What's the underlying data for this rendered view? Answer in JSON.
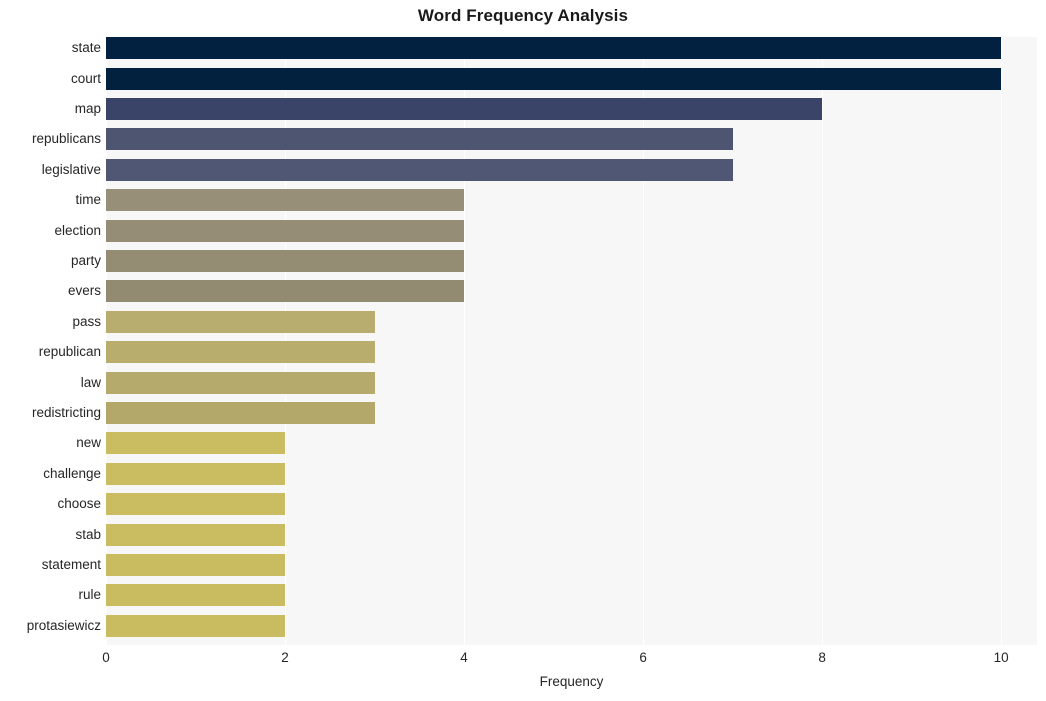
{
  "chart_data": {
    "type": "bar",
    "orientation": "horizontal",
    "title": "Word Frequency Analysis",
    "xlabel": "Frequency",
    "ylabel": "",
    "xlim": [
      0,
      10.4
    ],
    "xticks": [
      0,
      2,
      4,
      6,
      8,
      10
    ],
    "xtick_labels": [
      "0",
      "2",
      "4",
      "6",
      "8",
      "10"
    ],
    "grid": true,
    "grid_axis": "x",
    "legend": null,
    "categories": [
      "state",
      "court",
      "map",
      "republicans",
      "legislative",
      "time",
      "election",
      "party",
      "evers",
      "pass",
      "republican",
      "law",
      "redistricting",
      "new",
      "challenge",
      "choose",
      "stab",
      "statement",
      "rule",
      "protasiewicz"
    ],
    "values": [
      10,
      10,
      8,
      7,
      7,
      4,
      4,
      4,
      4,
      3,
      3,
      3,
      3,
      2,
      2,
      2,
      2,
      2,
      2,
      2
    ],
    "bar_colors": [
      "#02203f",
      "#02213f",
      "#3a4468",
      "#4d5571",
      "#4f5775",
      "#978f77",
      "#958d75",
      "#948d74",
      "#928b72",
      "#b8ad6e",
      "#b8ad6d",
      "#b5aa6b",
      "#b3a869",
      "#c9bc61",
      "#c9bc61",
      "#c9bc61",
      "#c9bc61",
      "#c9bc60",
      "#c9bc60",
      "#c9bc60"
    ],
    "plot_background": "#f7f7f7",
    "gridline_color": "#ffffff",
    "text_color": "#262626",
    "title_color": "#1a1a1a"
  }
}
